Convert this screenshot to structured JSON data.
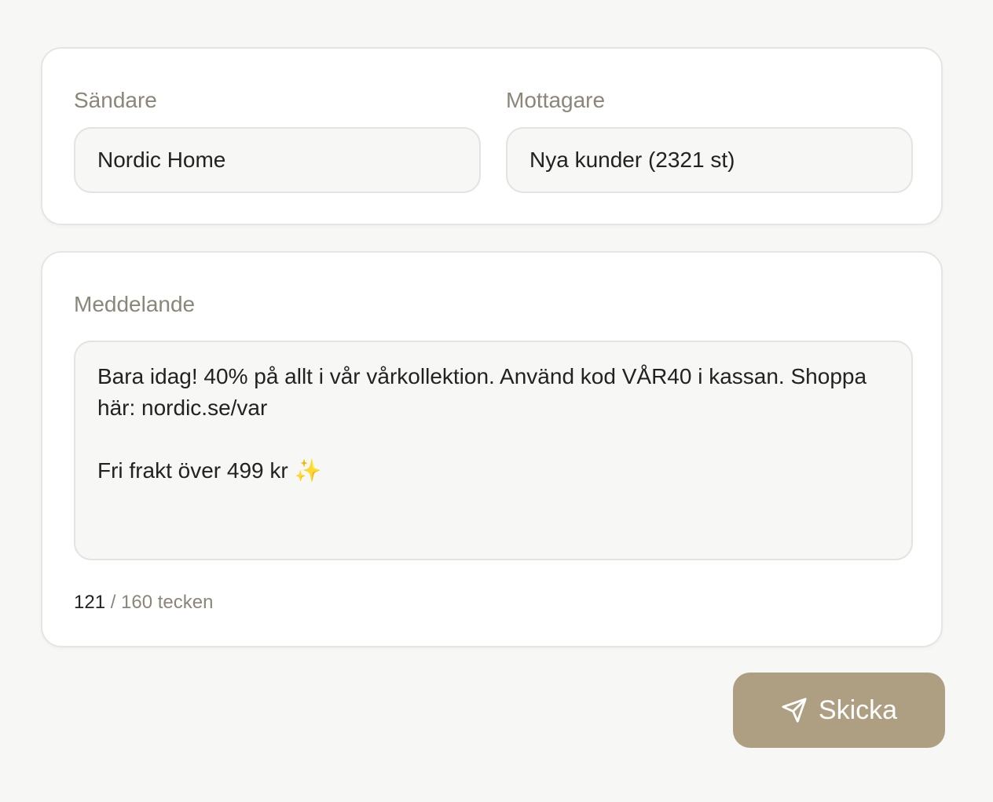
{
  "form": {
    "sender": {
      "label": "Sändare",
      "value": "Nordic Home"
    },
    "recipient": {
      "label": "Mottagare",
      "value": "Nya kunder (2321 st)"
    }
  },
  "message": {
    "label": "Meddelande",
    "line1": "Bara idag! 40% på allt i vår vårkollektion. Använd kod VÅR40 i kassan. Shoppa",
    "line2": "här: nordic.se/var",
    "line3": "Fri frakt över 499 kr ",
    "emoji": "✨",
    "counter_current": "121",
    "counter_rest": " / 160 tecken"
  },
  "actions": {
    "send_label": "Skicka",
    "send_icon": "paper-plane-icon"
  },
  "colors": {
    "background": "#f7f7f5",
    "accent": "#ae9f83",
    "label": "#8b8678"
  }
}
